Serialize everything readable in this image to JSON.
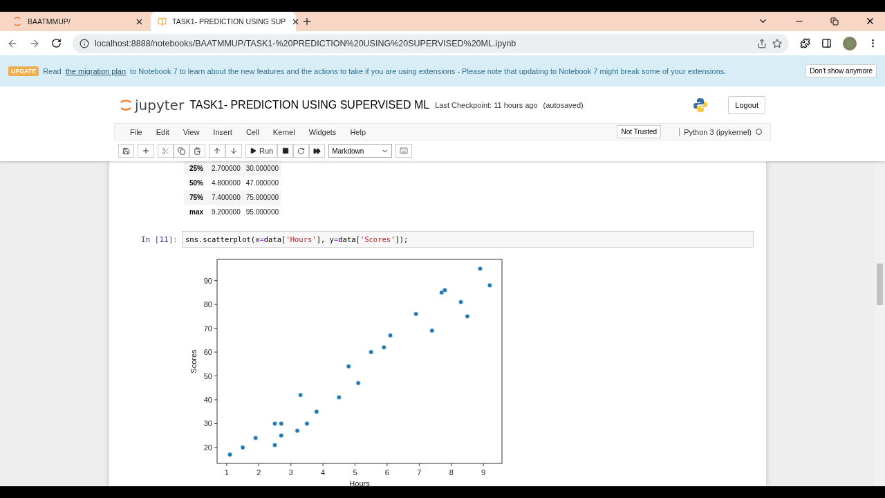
{
  "browser": {
    "tabs": [
      {
        "title": "BAATMMUP/",
        "selected": false
      },
      {
        "title": "TASK1- PREDICTION USING SUP",
        "selected": true
      }
    ],
    "url": "localhost:8888/notebooks/BAATMMUP/TASK1-%20PREDICTION%20USING%20SUPERVISED%20ML.ipynb"
  },
  "banner": {
    "badge": "UPDATE",
    "text_before": "Read",
    "link": "the migration plan",
    "text_after": "to Notebook 7 to learn about the new features and the actions to take if you are using extensions - Please note that updating to Notebook 7 might break some of your extensions.",
    "button": "Don't show anymore"
  },
  "header": {
    "logo": "jupyter",
    "title": "TASK1- PREDICTION USING SUPERVISED ML",
    "checkpoint": "Last Checkpoint: 11 hours ago",
    "autosave": "(autosaved)",
    "logout": "Logout"
  },
  "menu": [
    "File",
    "Edit",
    "View",
    "Insert",
    "Cell",
    "Kernel",
    "Widgets",
    "Help"
  ],
  "trust": "Not Trusted",
  "kernel": "Python 3 (ipykernel)",
  "toolbar": {
    "run": "Run",
    "cell_type": "Markdown"
  },
  "table_rows": [
    {
      "label": "25%",
      "hours": "2.700000",
      "scores": "30.000000"
    },
    {
      "label": "50%",
      "hours": "4.800000",
      "scores": "47.000000"
    },
    {
      "label": "75%",
      "hours": "7.400000",
      "scores": "75.000000"
    },
    {
      "label": "max",
      "hours": "9.200000",
      "scores": "95.000000"
    }
  ],
  "cell": {
    "prompt": "In [11]:",
    "code_parts": [
      {
        "kind": "plain",
        "text": "sns.scatterplot(x"
      },
      {
        "kind": "op",
        "text": "="
      },
      {
        "kind": "plain",
        "text": "data["
      },
      {
        "kind": "str",
        "text": "'Hours'"
      },
      {
        "kind": "plain",
        "text": "], y"
      },
      {
        "kind": "op",
        "text": "="
      },
      {
        "kind": "plain",
        "text": "data["
      },
      {
        "kind": "str",
        "text": "'Scores'"
      },
      {
        "kind": "plain",
        "text": "]);"
      }
    ]
  },
  "chart_data": {
    "type": "scatter",
    "xlabel": "Hours",
    "ylabel": "Scores",
    "xlim": [
      0.7,
      9.58
    ],
    "ylim": [
      13.3,
      98.9
    ],
    "xticks": [
      1,
      2,
      3,
      4,
      5,
      6,
      7,
      8,
      9
    ],
    "yticks": [
      20,
      30,
      40,
      50,
      60,
      70,
      80,
      90
    ],
    "x": [
      2.5,
      5.1,
      3.2,
      8.5,
      3.5,
      1.5,
      9.2,
      5.5,
      8.3,
      2.7,
      7.7,
      5.9,
      4.5,
      3.3,
      1.1,
      8.9,
      2.5,
      1.9,
      6.1,
      7.4,
      2.7,
      4.8,
      3.8,
      6.9,
      7.8
    ],
    "series": [
      {
        "color": "#1f77b4",
        "values": [
          21,
          47,
          27,
          75,
          30,
          20,
          88,
          60,
          81,
          25,
          85,
          62,
          41,
          42,
          17,
          95,
          30,
          24,
          67,
          69,
          30,
          54,
          35,
          76,
          86
        ]
      }
    ]
  }
}
